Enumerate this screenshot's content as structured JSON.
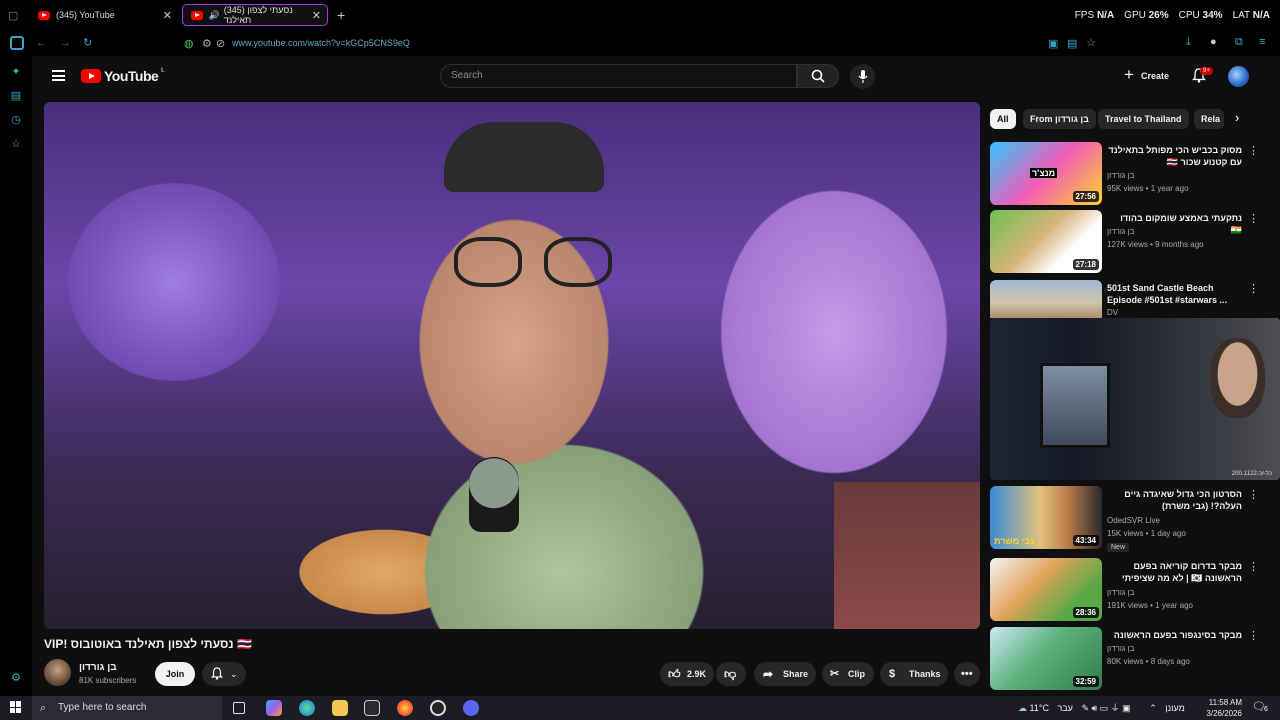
{
  "browser": {
    "tabs": [
      {
        "label": "(345) YouTube"
      },
      {
        "label": "(345) נסעתי לצפון תאילנד"
      }
    ],
    "perf": {
      "fps_label": "FPS",
      "fps": "N/A",
      "gpu_label": "GPU",
      "gpu": "26%",
      "cpu_label": "CPU",
      "cpu": "34%",
      "lat_label": "LAT",
      "lat": "N/A"
    },
    "url": "www.youtube.com/watch?v=kGCp5CNS9eQ"
  },
  "youtube": {
    "logo_text": "YouTube",
    "logo_country": "IL",
    "search_placeholder": "Search",
    "create_label": "Create",
    "notif_badge": "9+",
    "video_title": "VIP! נסעתי לצפון תאילנד באוטובוס 🇹🇭",
    "channel": {
      "name": "בן גורדון",
      "subs": "81K subscribers"
    },
    "join_label": "Join",
    "actions": {
      "likes": "2.9K",
      "share": "Share",
      "clip": "Clip",
      "thanks": "Thanks"
    },
    "chips": [
      "All",
      "From בן גורדון",
      "Travel to Thailand",
      "Rela"
    ],
    "recs": [
      {
        "title": "מסוק בכביש הכי מפותל בתאילנד עם קטנוע שכור 🇹🇭",
        "channel": "בן גורדון",
        "meta": "95K views • 1 year ago",
        "duration": "27:56"
      },
      {
        "title": "נתקעתי באמצע שומקום בהודו 🇮🇳",
        "channel": "בן גורדון",
        "meta": "127K views • 9 months ago",
        "duration": "27:18"
      },
      {
        "title": "501st Sand Castle Beach Episode #501st #starwars ...",
        "channel": "DV",
        "meta": "",
        "duration": ""
      },
      {
        "title": "הסרטון הכי גדול שאיגדה גיים העלה?! (גבי משרת)",
        "channel": "OdedSVR Live",
        "meta": "15K views • 1 day ago",
        "duration": "43:34",
        "badge": "New"
      },
      {
        "title": "מבקר בדרום קוריאה בפעם הראשונה 🇰🇷 | לא מה שציפיתי",
        "channel": "בן גורדון",
        "meta": "191K views • 1 year ago",
        "duration": "28:36"
      },
      {
        "title": "מבקר בסינגפור בפעם הראשונה",
        "channel": "בן גורדון",
        "meta": "80K views • 8 days ago",
        "duration": "32:59"
      }
    ],
    "thumb_text": {
      "t1": "מנצ'ר",
      "t4": "גבי משרת"
    },
    "webcam_caption": "כל-זכ-200.1122"
  },
  "taskbar": {
    "search_placeholder": "Type here to search",
    "weather": "11°C",
    "weather_label": "מעונן",
    "lang": "עבר",
    "time": "11:58 AM",
    "date": "3/26/2026",
    "notif_count": "6"
  },
  "colors": {
    "accent": "#ff0000",
    "tab_border": "#a63dd6",
    "url": "#5fa8d3"
  }
}
